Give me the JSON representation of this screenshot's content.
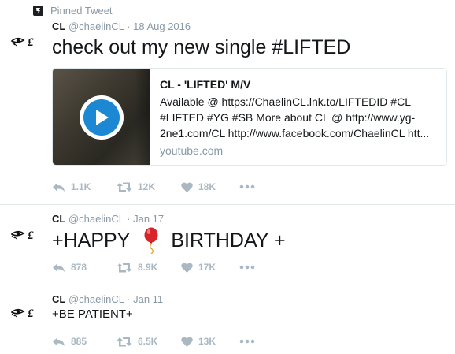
{
  "pinned_label": "Pinned Tweet",
  "tweets": [
    {
      "name": "CL",
      "handle": "@chaelinCL",
      "date": "18 Aug 2016",
      "text": "check out my new single #LIFTED",
      "card": {
        "title": "CL - 'LIFTED' M/V",
        "description": "Available @ https://ChaelinCL.lnk.to/LIFTEDID #CL\n#LIFTED #YG #SB More about CL @ http://www.yg-\n2ne1.com/CL http://www.facebook.com/ChaelinCL htt...",
        "domain": "youtube.com"
      },
      "replies": "1.1K",
      "retweets": "12K",
      "likes": "18K"
    },
    {
      "name": "CL",
      "handle": "@chaelinCL",
      "date": "Jan 17",
      "text_before": "+HAPPY",
      "text_after": "BIRTHDAY +",
      "replies": "878",
      "retweets": "8.9K",
      "likes": "17K"
    },
    {
      "name": "CL",
      "handle": "@chaelinCL",
      "date": "Jan 11",
      "text": "+BE PATIENT+",
      "replies": "885",
      "retweets": "6.5K",
      "likes": "13K"
    }
  ],
  "separator": "·",
  "icons": {
    "reply": "reply-icon",
    "retweet": "retweet-icon",
    "like": "heart-icon",
    "more": "more-icon",
    "pin": "pin-icon",
    "balloon": "balloon-emoji"
  }
}
